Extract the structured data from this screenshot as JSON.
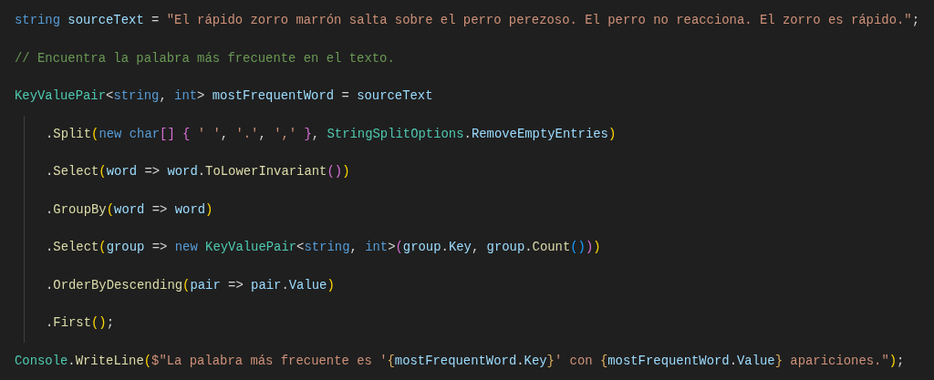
{
  "editor": {
    "lines": [
      {
        "tokens": [
          {
            "kind": "keyword",
            "text": "string "
          },
          {
            "kind": "variable",
            "text": "sourceText"
          },
          {
            "kind": "plain",
            "text": " = "
          },
          {
            "kind": "string",
            "text": "\"El rápido zorro marrón salta sobre el perro perezoso. El perro no reacciona. El zorro es rápido.\""
          },
          {
            "kind": "plain",
            "text": ";"
          }
        ]
      },
      {
        "tokens": [
          {
            "kind": "comment",
            "text": "// Encuentra la palabra más frecuente en el texto."
          }
        ]
      },
      {
        "tokens": [
          {
            "kind": "type",
            "text": "KeyValuePair"
          },
          {
            "kind": "plain",
            "text": "<"
          },
          {
            "kind": "keyword",
            "text": "string"
          },
          {
            "kind": "plain",
            "text": ", "
          },
          {
            "kind": "keyword",
            "text": "int"
          },
          {
            "kind": "plain",
            "text": "> "
          },
          {
            "kind": "variable",
            "text": "mostFrequentWord"
          },
          {
            "kind": "plain",
            "text": " = "
          },
          {
            "kind": "variable",
            "text": "sourceText"
          }
        ],
        "children": [
          {
            "tokens": [
              {
                "kind": "plain",
                "text": "."
              },
              {
                "kind": "method",
                "text": "Split"
              },
              {
                "kind": "bracket1",
                "text": "("
              },
              {
                "kind": "keyword",
                "text": "new "
              },
              {
                "kind": "keyword",
                "text": "char"
              },
              {
                "kind": "bracket2",
                "text": "[] "
              },
              {
                "kind": "bracket2",
                "text": "{ "
              },
              {
                "kind": "string",
                "text": "' '"
              },
              {
                "kind": "plain",
                "text": ", "
              },
              {
                "kind": "string",
                "text": "'.'"
              },
              {
                "kind": "plain",
                "text": ", "
              },
              {
                "kind": "string",
                "text": "',' "
              },
              {
                "kind": "bracket2",
                "text": "}"
              },
              {
                "kind": "plain",
                "text": ", "
              },
              {
                "kind": "type",
                "text": "StringSplitOptions"
              },
              {
                "kind": "plain",
                "text": "."
              },
              {
                "kind": "variable",
                "text": "RemoveEmptyEntries"
              },
              {
                "kind": "bracket1",
                "text": ")"
              }
            ]
          },
          {
            "tokens": [
              {
                "kind": "plain",
                "text": "."
              },
              {
                "kind": "method",
                "text": "Select"
              },
              {
                "kind": "bracket1",
                "text": "("
              },
              {
                "kind": "variable",
                "text": "word"
              },
              {
                "kind": "plain",
                "text": " => "
              },
              {
                "kind": "variable",
                "text": "word"
              },
              {
                "kind": "plain",
                "text": "."
              },
              {
                "kind": "method",
                "text": "ToLowerInvariant"
              },
              {
                "kind": "bracket2",
                "text": "()"
              },
              {
                "kind": "bracket1",
                "text": ")"
              }
            ]
          },
          {
            "tokens": [
              {
                "kind": "plain",
                "text": "."
              },
              {
                "kind": "method",
                "text": "GroupBy"
              },
              {
                "kind": "bracket1",
                "text": "("
              },
              {
                "kind": "variable",
                "text": "word"
              },
              {
                "kind": "plain",
                "text": " => "
              },
              {
                "kind": "variable",
                "text": "word"
              },
              {
                "kind": "bracket1",
                "text": ")"
              }
            ]
          },
          {
            "tokens": [
              {
                "kind": "plain",
                "text": "."
              },
              {
                "kind": "method",
                "text": "Select"
              },
              {
                "kind": "bracket1",
                "text": "("
              },
              {
                "kind": "variable",
                "text": "group"
              },
              {
                "kind": "plain",
                "text": " => "
              },
              {
                "kind": "keyword",
                "text": "new "
              },
              {
                "kind": "type",
                "text": "KeyValuePair"
              },
              {
                "kind": "plain",
                "text": "<"
              },
              {
                "kind": "keyword",
                "text": "string"
              },
              {
                "kind": "plain",
                "text": ", "
              },
              {
                "kind": "keyword",
                "text": "int"
              },
              {
                "kind": "plain",
                "text": ">"
              },
              {
                "kind": "bracket2",
                "text": "("
              },
              {
                "kind": "variable",
                "text": "group"
              },
              {
                "kind": "plain",
                "text": "."
              },
              {
                "kind": "variable",
                "text": "Key"
              },
              {
                "kind": "plain",
                "text": ", "
              },
              {
                "kind": "variable",
                "text": "group"
              },
              {
                "kind": "plain",
                "text": "."
              },
              {
                "kind": "method",
                "text": "Count"
              },
              {
                "kind": "bracket3",
                "text": "()"
              },
              {
                "kind": "bracket2",
                "text": ")"
              },
              {
                "kind": "bracket1",
                "text": ")"
              }
            ]
          },
          {
            "tokens": [
              {
                "kind": "plain",
                "text": "."
              },
              {
                "kind": "method",
                "text": "OrderByDescending"
              },
              {
                "kind": "bracket1",
                "text": "("
              },
              {
                "kind": "variable",
                "text": "pair"
              },
              {
                "kind": "plain",
                "text": " => "
              },
              {
                "kind": "variable",
                "text": "pair"
              },
              {
                "kind": "plain",
                "text": "."
              },
              {
                "kind": "variable",
                "text": "Value"
              },
              {
                "kind": "bracket1",
                "text": ")"
              }
            ]
          },
          {
            "tokens": [
              {
                "kind": "plain",
                "text": "."
              },
              {
                "kind": "method",
                "text": "First"
              },
              {
                "kind": "bracket1",
                "text": "()"
              },
              {
                "kind": "plain",
                "text": ";"
              }
            ]
          }
        ]
      },
      {
        "tokens": [
          {
            "kind": "type",
            "text": "Console"
          },
          {
            "kind": "plain",
            "text": "."
          },
          {
            "kind": "method",
            "text": "WriteLine"
          },
          {
            "kind": "bracket1",
            "text": "("
          },
          {
            "kind": "string",
            "text": "$\"La palabra más frecuente es '"
          },
          {
            "kind": "brace",
            "text": "{"
          },
          {
            "kind": "variable",
            "text": "mostFrequentWord"
          },
          {
            "kind": "plain",
            "text": "."
          },
          {
            "kind": "variable",
            "text": "Key"
          },
          {
            "kind": "brace",
            "text": "}"
          },
          {
            "kind": "string",
            "text": "' con "
          },
          {
            "kind": "brace",
            "text": "{"
          },
          {
            "kind": "variable",
            "text": "mostFrequentWord"
          },
          {
            "kind": "plain",
            "text": "."
          },
          {
            "kind": "variable",
            "text": "Value"
          },
          {
            "kind": "brace",
            "text": "}"
          },
          {
            "kind": "string",
            "text": " apariciones.\""
          },
          {
            "kind": "bracket1",
            "text": ")"
          },
          {
            "kind": "plain",
            "text": ";"
          }
        ]
      }
    ]
  }
}
